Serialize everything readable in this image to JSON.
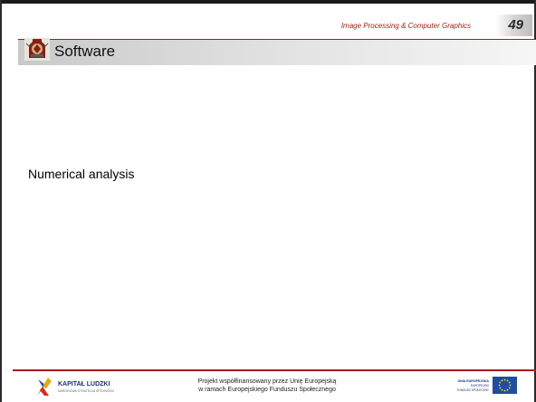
{
  "header": {
    "course_title": "Image Processing & Computer Graphics",
    "page_number": "49"
  },
  "slide": {
    "title": "Software",
    "body_text": "Numerical analysis"
  },
  "footer": {
    "kapital_name": "KAPITAŁ LUDZKI",
    "kapital_subtitle": "NARODOWA STRATEGIA SPÓJNOŚCI",
    "funding_line_1": "Projekt współfinansowany przez Unię Europejską",
    "funding_line_2": "w ramach Europejskiego Funduszu Społecznego",
    "ue_line_1": "UNIA EUROPEJSKA",
    "ue_line_2": "EUROPEJSKI",
    "ue_line_3": "FUNDUSZ SPOŁECZNY"
  },
  "colors": {
    "accent_red": "#a51c12",
    "title_band": "#d9d9d9",
    "eu_blue": "#1f4ea1",
    "eu_star": "#ffd617"
  }
}
